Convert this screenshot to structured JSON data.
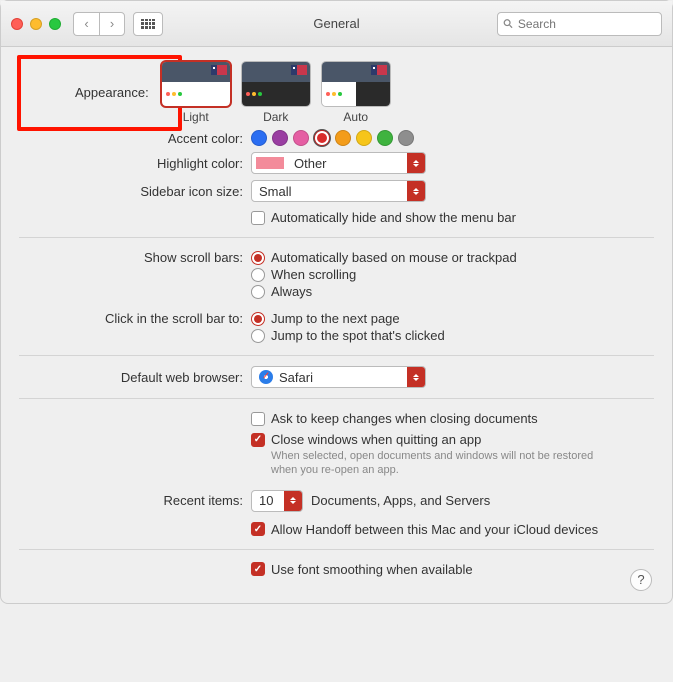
{
  "window": {
    "title": "General",
    "search_placeholder": "Search"
  },
  "appearance": {
    "label": "Appearance:",
    "options": [
      "Light",
      "Dark",
      "Auto"
    ],
    "selected": "Light"
  },
  "accent": {
    "label": "Accent color:",
    "colors": [
      "#2b6ef2",
      "#9a3ea2",
      "#e55ea3",
      "#d92b2b",
      "#f39c1a",
      "#f6c51a",
      "#3fb33f",
      "#8e8e8e"
    ],
    "selected_index": 3
  },
  "highlight": {
    "label": "Highlight color:",
    "value": "Other"
  },
  "sidebar": {
    "label": "Sidebar icon size:",
    "value": "Small"
  },
  "autohide": {
    "label": "Automatically hide and show the menu bar",
    "checked": false
  },
  "scrollbars": {
    "label": "Show scroll bars:",
    "options": [
      "Automatically based on mouse or trackpad",
      "When scrolling",
      "Always"
    ],
    "selected_index": 0
  },
  "scrollclick": {
    "label": "Click in the scroll bar to:",
    "options": [
      "Jump to the next page",
      "Jump to the spot that's clicked"
    ],
    "selected_index": 0
  },
  "browser": {
    "label": "Default web browser:",
    "value": "Safari"
  },
  "docs": {
    "ask": "Ask to keep changes when closing documents",
    "close": "Close windows when quitting an app",
    "close_fine": "When selected, open documents and windows will not be restored when you re-open an app.",
    "ask_checked": false,
    "close_checked": true
  },
  "recent": {
    "label": "Recent items:",
    "value": "10",
    "suffix": "Documents, Apps, and Servers"
  },
  "handoff": {
    "label": "Allow Handoff between this Mac and your iCloud devices",
    "checked": true
  },
  "smoothing": {
    "label": "Use font smoothing when available",
    "checked": true
  },
  "help": "?"
}
